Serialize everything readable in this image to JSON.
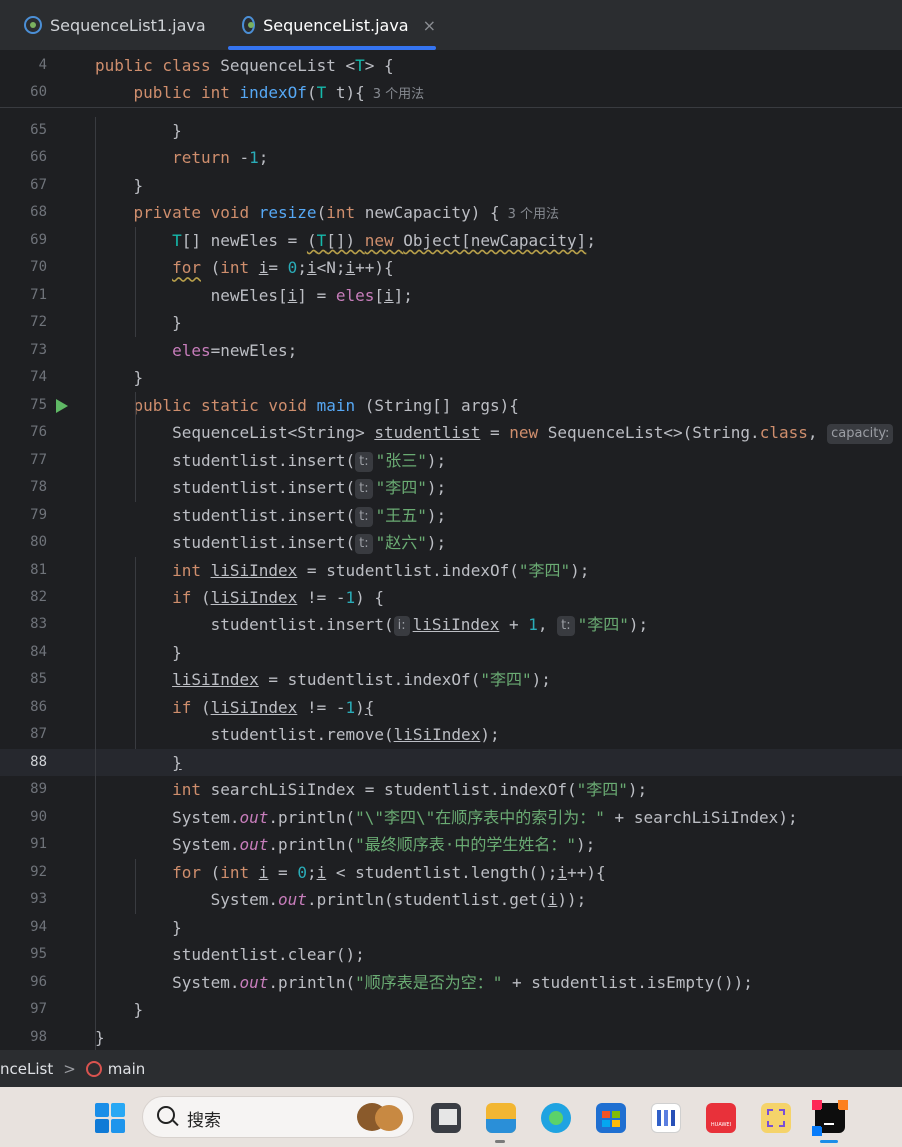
{
  "tabs": [
    {
      "label": "SequenceList1.java",
      "active": false
    },
    {
      "label": "SequenceList.java",
      "active": true,
      "close": "×"
    }
  ],
  "sticky": [
    {
      "num": "4",
      "tokens": [
        [
          "kw",
          "public class "
        ],
        [
          "",
          "SequenceList <"
        ],
        [
          "tp",
          "T"
        ],
        [
          "",
          "> {"
        ]
      ]
    },
    {
      "num": "60",
      "tokens": [
        [
          "",
          "    "
        ],
        [
          "kw",
          "public int "
        ],
        [
          "fn",
          "indexOf"
        ],
        [
          "",
          "("
        ],
        [
          "tp",
          "T"
        ],
        [
          "",
          " t){"
        ],
        [
          "usage",
          "3 个用法"
        ]
      ]
    }
  ],
  "lines": [
    {
      "num": "65",
      "tokens": [
        [
          "",
          "        }"
        ]
      ]
    },
    {
      "num": "66",
      "tokens": [
        [
          "",
          "        "
        ],
        [
          "kw",
          "return "
        ],
        [
          "",
          "-"
        ],
        [
          "num",
          "1"
        ],
        [
          "",
          ";"
        ]
      ]
    },
    {
      "num": "67",
      "tokens": [
        [
          "",
          "    }"
        ]
      ]
    },
    {
      "num": "68",
      "tokens": [
        [
          "",
          "    "
        ],
        [
          "kw",
          "private void "
        ],
        [
          "fn",
          "resize"
        ],
        [
          "",
          "("
        ],
        [
          "kw",
          "int "
        ],
        [
          "",
          "newCapacity) {"
        ],
        [
          "usage",
          "3 个用法"
        ]
      ]
    },
    {
      "num": "69",
      "tokens": [
        [
          "",
          "        "
        ],
        [
          "tp",
          "T"
        ],
        [
          "",
          "[] newEles = "
        ],
        [
          "wav",
          "("
        ],
        [
          "wavtp",
          "T"
        ],
        [
          "wav",
          "[]) "
        ],
        [
          "wavkw",
          "new "
        ],
        [
          "wav",
          "Object[newCapacity]"
        ],
        [
          "",
          ";"
        ]
      ]
    },
    {
      "num": "70",
      "tokens": [
        [
          "",
          "        "
        ],
        [
          "wavkw",
          "for"
        ],
        [
          "",
          " ("
        ],
        [
          "kw",
          "int "
        ],
        [
          "ul",
          "i"
        ],
        [
          "",
          "= "
        ],
        [
          "num",
          "0"
        ],
        [
          "",
          ";"
        ],
        [
          "ul",
          "i"
        ],
        [
          "",
          "<N;"
        ],
        [
          "ul",
          "i"
        ],
        [
          "",
          "++){"
        ]
      ]
    },
    {
      "num": "71",
      "tokens": [
        [
          "",
          "            newEles["
        ],
        [
          "ul",
          "i"
        ],
        [
          "",
          "] = "
        ],
        [
          "fld",
          "eles"
        ],
        [
          "",
          "["
        ],
        [
          "ul",
          "i"
        ],
        [
          "",
          "];"
        ]
      ]
    },
    {
      "num": "72",
      "tokens": [
        [
          "",
          "        }"
        ]
      ]
    },
    {
      "num": "73",
      "tokens": [
        [
          "",
          "        "
        ],
        [
          "fld",
          "eles"
        ],
        [
          "",
          "=newEles;"
        ]
      ]
    },
    {
      "num": "74",
      "tokens": [
        [
          "",
          "    }"
        ]
      ]
    },
    {
      "num": "75",
      "run": true,
      "tokens": [
        [
          "",
          "    "
        ],
        [
          "kw",
          "public static void "
        ],
        [
          "fn",
          "main"
        ],
        [
          "",
          " (String[] args){"
        ]
      ]
    },
    {
      "num": "76",
      "tokens": [
        [
          "",
          "        SequenceList<String> "
        ],
        [
          "ul",
          "studentlist"
        ],
        [
          "",
          " = "
        ],
        [
          "kw",
          "new "
        ],
        [
          "",
          "SequenceList<>(String."
        ],
        [
          "kw",
          "class"
        ],
        [
          "",
          ", "
        ],
        [
          "hint",
          "capacity:"
        ]
      ]
    },
    {
      "num": "77",
      "tokens": [
        [
          "",
          "        studentlist.insert("
        ],
        [
          "hint",
          "t:"
        ],
        [
          "str",
          "\"张三\""
        ],
        [
          "",
          ");"
        ]
      ]
    },
    {
      "num": "78",
      "tokens": [
        [
          "",
          "        studentlist.insert("
        ],
        [
          "hint",
          "t:"
        ],
        [
          "str",
          "\"李四\""
        ],
        [
          "",
          ");"
        ]
      ]
    },
    {
      "num": "79",
      "tokens": [
        [
          "",
          "        studentlist.insert("
        ],
        [
          "hint",
          "t:"
        ],
        [
          "str",
          "\"王五\""
        ],
        [
          "",
          ");"
        ]
      ]
    },
    {
      "num": "80",
      "tokens": [
        [
          "",
          "        studentlist.insert("
        ],
        [
          "hint",
          "t:"
        ],
        [
          "str",
          "\"赵六\""
        ],
        [
          "",
          ");"
        ]
      ]
    },
    {
      "num": "81",
      "tokens": [
        [
          "",
          "        "
        ],
        [
          "kw",
          "int "
        ],
        [
          "ul",
          "liSiIndex"
        ],
        [
          "",
          " = studentlist.indexOf("
        ],
        [
          "str",
          "\"李四\""
        ],
        [
          "",
          ");"
        ]
      ]
    },
    {
      "num": "82",
      "tokens": [
        [
          "",
          "        "
        ],
        [
          "kw",
          "if "
        ],
        [
          "",
          "("
        ],
        [
          "ul",
          "liSiIndex"
        ],
        [
          "",
          " != -"
        ],
        [
          "num",
          "1"
        ],
        [
          "",
          ") {"
        ]
      ]
    },
    {
      "num": "83",
      "tokens": [
        [
          "",
          "            studentlist.insert("
        ],
        [
          "hint",
          "i:"
        ],
        [
          "ul",
          "liSiIndex"
        ],
        [
          "",
          " + "
        ],
        [
          "num",
          "1"
        ],
        [
          "",
          ", "
        ],
        [
          "hint",
          "t:"
        ],
        [
          "str",
          "\"李四\""
        ],
        [
          "",
          ");"
        ]
      ]
    },
    {
      "num": "84",
      "tokens": [
        [
          "",
          "        }"
        ]
      ]
    },
    {
      "num": "85",
      "tokens": [
        [
          "",
          "        "
        ],
        [
          "ul",
          "liSiIndex"
        ],
        [
          "",
          " = studentlist.indexOf("
        ],
        [
          "str",
          "\"李四\""
        ],
        [
          "",
          ");"
        ]
      ]
    },
    {
      "num": "86",
      "tokens": [
        [
          "",
          "        "
        ],
        [
          "kw",
          "if "
        ],
        [
          "",
          "("
        ],
        [
          "ul",
          "liSiIndex"
        ],
        [
          "",
          " != -"
        ],
        [
          "num",
          "1"
        ],
        [
          "",
          ")"
        ],
        [
          "ul",
          "{"
        ]
      ]
    },
    {
      "num": "87",
      "tokens": [
        [
          "",
          "            studentlist.remove("
        ],
        [
          "ul",
          "liSiIndex"
        ],
        [
          "",
          ");"
        ]
      ]
    },
    {
      "num": "88",
      "current": true,
      "tokens": [
        [
          "",
          "        "
        ],
        [
          "ul",
          "}"
        ]
      ]
    },
    {
      "num": "89",
      "tokens": [
        [
          "",
          "        "
        ],
        [
          "kw",
          "int "
        ],
        [
          "",
          "searchLiSiIndex = studentlist.indexOf("
        ],
        [
          "str",
          "\"李四\""
        ],
        [
          "",
          ");"
        ]
      ]
    },
    {
      "num": "90",
      "tokens": [
        [
          "",
          "        System."
        ],
        [
          "ital",
          "out"
        ],
        [
          "",
          ".println("
        ],
        [
          "str",
          "\"\\\"李四\\\"在顺序表中的索引为：\""
        ],
        [
          "",
          " + searchLiSiIndex);"
        ]
      ]
    },
    {
      "num": "91",
      "tokens": [
        [
          "",
          "        System."
        ],
        [
          "ital",
          "out"
        ],
        [
          "",
          ".println("
        ],
        [
          "str",
          "\"最终顺序表·中的学生姓名：\""
        ],
        [
          "",
          ");"
        ]
      ]
    },
    {
      "num": "92",
      "tokens": [
        [
          "",
          "        "
        ],
        [
          "kw",
          "for "
        ],
        [
          "",
          "("
        ],
        [
          "kw",
          "int "
        ],
        [
          "ul",
          "i"
        ],
        [
          "",
          " = "
        ],
        [
          "num",
          "0"
        ],
        [
          "",
          ";"
        ],
        [
          "ul",
          "i"
        ],
        [
          "",
          " < studentlist.length();"
        ],
        [
          "ul",
          "i"
        ],
        [
          "",
          "++){"
        ]
      ]
    },
    {
      "num": "93",
      "tokens": [
        [
          "",
          "            System."
        ],
        [
          "ital",
          "out"
        ],
        [
          "",
          ".println(studentlist.get("
        ],
        [
          "ul",
          "i"
        ],
        [
          "",
          "));"
        ]
      ]
    },
    {
      "num": "94",
      "tokens": [
        [
          "",
          "        }"
        ]
      ]
    },
    {
      "num": "95",
      "tokens": [
        [
          "",
          "        studentlist.clear();"
        ]
      ]
    },
    {
      "num": "96",
      "tokens": [
        [
          "",
          "        System."
        ],
        [
          "ital",
          "out"
        ],
        [
          "",
          ".println("
        ],
        [
          "str",
          "\"顺序表是否为空：\""
        ],
        [
          "",
          " + studentlist.isEmpty());"
        ]
      ]
    },
    {
      "num": "97",
      "tokens": [
        [
          "",
          "    }"
        ]
      ]
    },
    {
      "num": "98",
      "tokens": [
        [
          "",
          "}"
        ]
      ]
    }
  ],
  "breadcrumb": {
    "class_label": "nceList",
    "separator": ">",
    "method_label": "main"
  },
  "taskbar": {
    "search_placeholder": "搜索",
    "huawei_label": "HUAWEI"
  }
}
